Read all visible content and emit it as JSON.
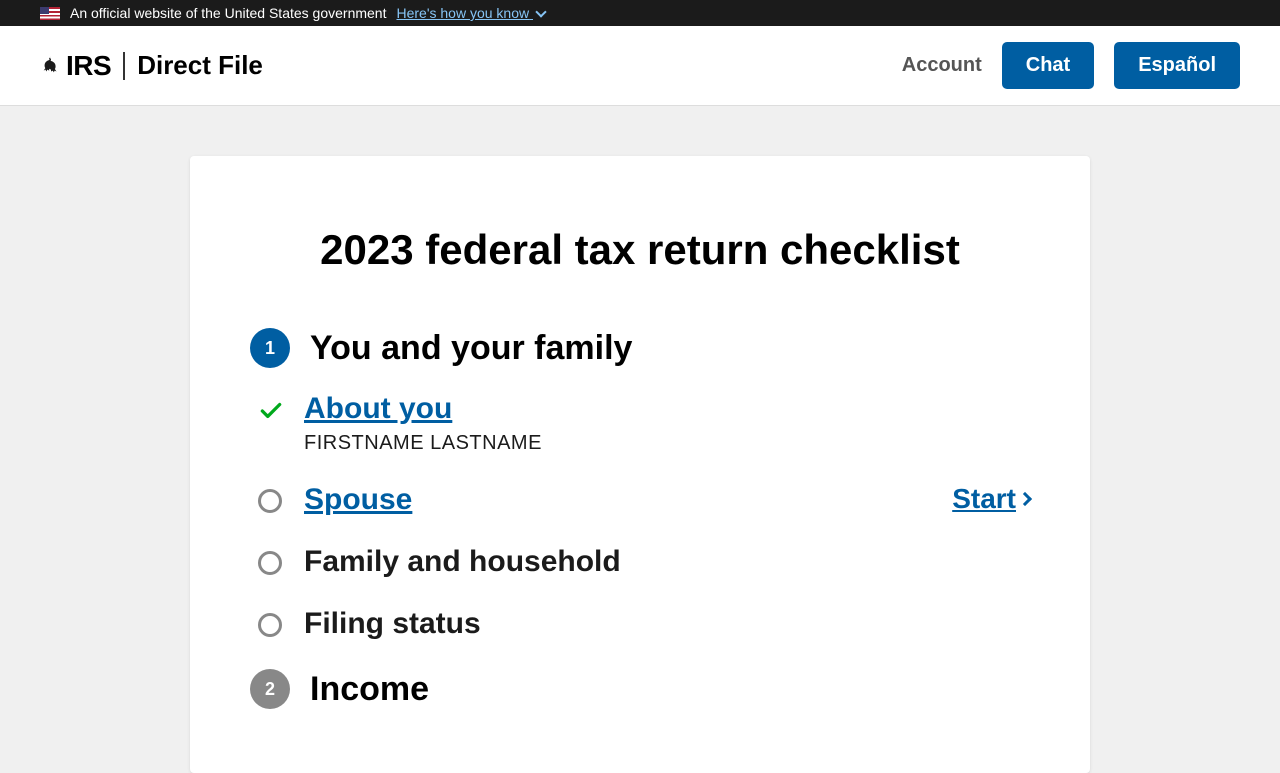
{
  "banner": {
    "text": "An official website of the United States government",
    "link": "Here's how you know"
  },
  "header": {
    "irs": "IRS",
    "product": "Direct File",
    "account": "Account",
    "chat": "Chat",
    "espanol": "Español"
  },
  "checklist": {
    "title": "2023 federal tax return checklist",
    "sections": [
      {
        "num": "1",
        "title": "You and your family",
        "active": true,
        "items": [
          {
            "label": "About you",
            "sub": "FIRSTNAME LASTNAME",
            "done": true,
            "link": true
          },
          {
            "label": "Spouse",
            "done": false,
            "link": true,
            "action": "Start"
          },
          {
            "label": "Family and household",
            "done": false,
            "link": false
          },
          {
            "label": "Filing status",
            "done": false,
            "link": false
          }
        ]
      },
      {
        "num": "2",
        "title": "Income",
        "active": false
      }
    ]
  }
}
